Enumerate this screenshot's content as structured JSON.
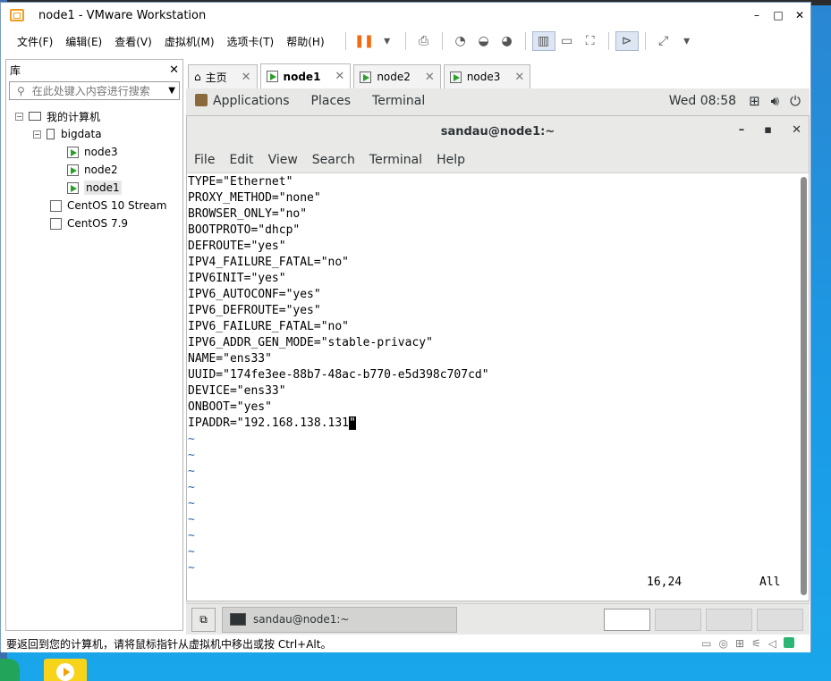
{
  "window": {
    "title": "node1 - VMware Workstation",
    "controls": [
      "–",
      "□",
      "✕"
    ]
  },
  "menubar": {
    "items": [
      "文件(F)",
      "编辑(E)",
      "查看(V)",
      "虚拟机(M)",
      "选项卡(T)",
      "帮助(H)"
    ]
  },
  "library": {
    "title": "库",
    "close": "✕",
    "search_placeholder": "在此处键入内容进行搜索",
    "tree": {
      "root": "我的计算机",
      "folder": "bigdata",
      "vms": [
        "node3",
        "node2",
        "node1"
      ],
      "others": [
        "CentOS 10 Stream",
        "CentOS 7.9"
      ]
    }
  },
  "tabs": [
    {
      "label": "主页"
    },
    {
      "label": "node1"
    },
    {
      "label": "node2"
    },
    {
      "label": "node3"
    }
  ],
  "guest": {
    "topbar": {
      "applications": "Applications",
      "places": "Places",
      "terminal": "Terminal",
      "clock": "Wed 08:58"
    },
    "terminal": {
      "title": "sandau@node1:~",
      "controls": [
        "–",
        "▪",
        "✕"
      ],
      "menu": [
        "File",
        "Edit",
        "View",
        "Search",
        "Terminal",
        "Help"
      ],
      "lines": [
        "TYPE=\"Ethernet\"",
        "PROXY_METHOD=\"none\"",
        "BROWSER_ONLY=\"no\"",
        "BOOTPROTO=\"dhcp\"",
        "DEFROUTE=\"yes\"",
        "IPV4_FAILURE_FATAL=\"no\"",
        "IPV6INIT=\"yes\"",
        "IPV6_AUTOCONF=\"yes\"",
        "IPV6_DEFROUTE=\"yes\"",
        "IPV6_FAILURE_FATAL=\"no\"",
        "IPV6_ADDR_GEN_MODE=\"stable-privacy\"",
        "NAME=\"ens33\"",
        "UUID=\"174fe3ee-88b7-48ac-b770-e5d398c707cd\"",
        "DEVICE=\"ens33\"",
        "ONBOOT=\"yes\""
      ],
      "last_line_prefix": "IPADDR=\"192.168.138.131",
      "cursor_char": "\"",
      "tilde": "~",
      "position": "16,24",
      "scroll": "All"
    },
    "taskbar": {
      "task_label": "sandau@node1:~"
    }
  },
  "statusbar": {
    "hint": "要返回到您的计算机，请将鼠标指针从虚拟机中移出或按 Ctrl+Alt。"
  }
}
